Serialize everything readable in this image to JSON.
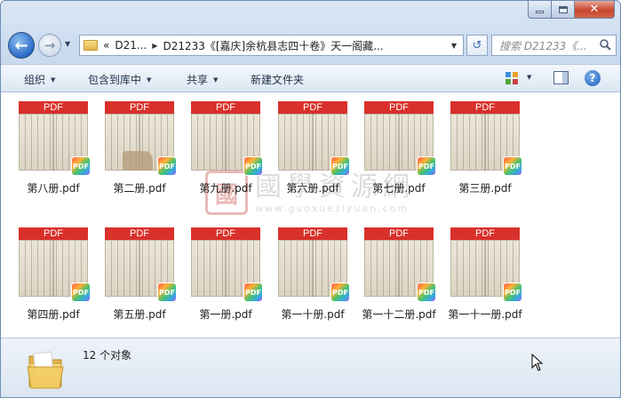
{
  "window": {
    "caption": {
      "close_glyph": "✕"
    }
  },
  "nav": {
    "back_glyph": "←",
    "forward_glyph": "→",
    "history_glyph": "▼",
    "address": {
      "prefix": "«",
      "crumb1": "D21...",
      "crumb2": "D21233《[嘉庆]余杭县志四十卷》天一阁藏...",
      "sep": "▶",
      "drop": "▼"
    },
    "refresh_glyph": "↺",
    "search_placeholder": "搜索 D21233《...",
    "search_icon": "search-icon"
  },
  "toolbar": {
    "organize": "组织",
    "include": "包含到库中",
    "share": "共享",
    "new_folder": "新建文件夹",
    "arrow": "▼",
    "help": "?"
  },
  "watermark": {
    "seal": "國",
    "main": "國學資源網",
    "url": "www.guoxueziyuan.com"
  },
  "files": [
    {
      "name": "第八册.pdf",
      "bar": "PDF",
      "badge": "PDF"
    },
    {
      "name": "第二册.pdf",
      "bar": "PDF",
      "badge": "PDF",
      "stain": true
    },
    {
      "name": "第九册.pdf",
      "bar": "PDF",
      "badge": "PDF"
    },
    {
      "name": "第六册.pdf",
      "bar": "PDF",
      "badge": "PDF"
    },
    {
      "name": "第七册.pdf",
      "bar": "PDF",
      "badge": "PDF"
    },
    {
      "name": "第三册.pdf",
      "bar": "PDF",
      "badge": "PDF"
    },
    {
      "name": "第四册.pdf",
      "bar": "PDF",
      "badge": "PDF"
    },
    {
      "name": "第五册.pdf",
      "bar": "PDF",
      "badge": "PDF"
    },
    {
      "name": "第一册.pdf",
      "bar": "PDF",
      "badge": "PDF"
    },
    {
      "name": "第一十册.pdf",
      "bar": "PDF",
      "badge": "PDF"
    },
    {
      "name": "第一十二册.pdf",
      "bar": "PDF",
      "badge": "PDF"
    },
    {
      "name": "第一十一册.pdf",
      "bar": "PDF",
      "badge": "PDF"
    }
  ],
  "status": {
    "count_text": "12 个对象"
  },
  "colors": {
    "pdf_bar": "#d9302b",
    "titlebar": "#c9daee",
    "close": "#c8462c"
  }
}
